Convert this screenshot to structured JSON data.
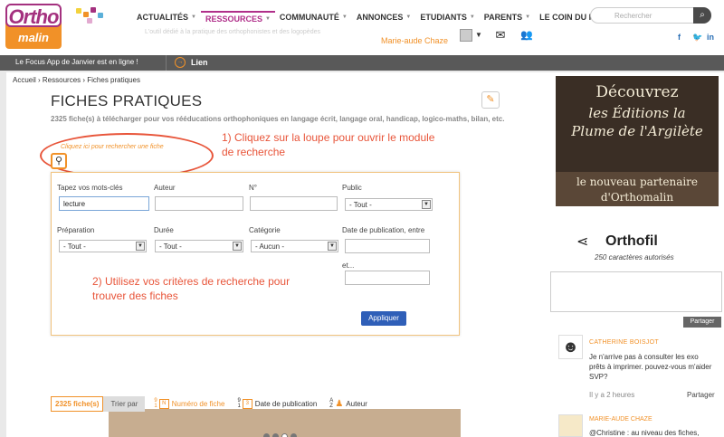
{
  "brand": {
    "logo_top": "Ortho",
    "logo_bottom": "malin",
    "accent": "#f19128",
    "brand_purple": "#a4317f"
  },
  "nav": {
    "items": [
      {
        "label": "ACTUALITÉS",
        "dropdown": true
      },
      {
        "label": "RESSOURCES",
        "dropdown": true,
        "active": true
      },
      {
        "label": "COMMUNAUTÉ",
        "dropdown": true
      },
      {
        "label": "ANNONCES",
        "dropdown": true
      },
      {
        "label": "ETUDIANTS",
        "dropdown": true
      },
      {
        "label": "PARENTS",
        "dropdown": true
      },
      {
        "label": "LE COIN DU PSY",
        "dropdown": true
      }
    ],
    "tagline": "L'outil dédié à la pratique des orthophonistes et des logopèdes"
  },
  "user": {
    "name": "Marie-aude Chaze"
  },
  "header": {
    "search_placeholder": "Rechercher",
    "icons": [
      "mail-icon",
      "users-icon"
    ],
    "social": [
      "facebook-icon",
      "twitter-icon",
      "linkedin-icon"
    ]
  },
  "focus_bar": {
    "message": "Le Focus App de Janvier est en ligne !",
    "link": "Lien"
  },
  "breadcrumb": [
    "Accueil",
    "Ressources",
    "Fiches pratiques"
  ],
  "page": {
    "title": "FICHES PRATIQUES",
    "description": "2325 fiche(s) à télécharger pour vos rééducations orthophoniques en langage écrit, langage oral, handicap, logico-maths, bilan, etc.",
    "search_hint": "Cliquez ici pour rechercher une fiche"
  },
  "annotations": {
    "step1": "1) Cliquez sur la loupe pour ouvrir le module de recherche",
    "step2": "2) Utilisez vos critères de recherche pour trouver des fiches",
    "color": "#e8553a"
  },
  "search_form": {
    "keywords_label": "Tapez vos mots-clés",
    "keywords_value": "lecture",
    "author_label": "Auteur",
    "number_label": "N°",
    "public_label": "Public",
    "public_value": "- Tout -",
    "preparation_label": "Préparation",
    "preparation_value": "- Tout -",
    "duration_label": "Durée",
    "duration_value": "- Tout -",
    "category_label": "Catégorie",
    "category_value": "- Aucun -",
    "date_label": "Date de publication, entre",
    "date_and": "et...",
    "apply_label": "Appliquer"
  },
  "sort_bar": {
    "count": "2325 fiche(s)",
    "sort_by": "Trier par",
    "options": [
      {
        "label": "Numéro de fiche",
        "selected": true
      },
      {
        "label": "Date de publication",
        "selected": false
      },
      {
        "label": "Auteur",
        "selected": false
      }
    ]
  },
  "ad": {
    "line1": "Découvrez",
    "line2": "les Éditions la",
    "line3": "Plume de l'Argilète",
    "line4": "le nouveau partenaire",
    "line5": "d'Orthomalin"
  },
  "orthofil": {
    "title": "Orthofil",
    "chars": "250 caractères autorisés",
    "share": "Partager"
  },
  "comments": [
    {
      "author": "CATHERINE BOISJOT",
      "text": "Je n'arrive pas à consulter les exo prêts à imprimer. pouvez-vous m'aider SVP?",
      "time": "Il y a 2 heures",
      "share": "Partager"
    },
    {
      "author": "MARIE-AUDE CHAZE",
      "text": "@Christine : au niveau des fiches,"
    }
  ]
}
